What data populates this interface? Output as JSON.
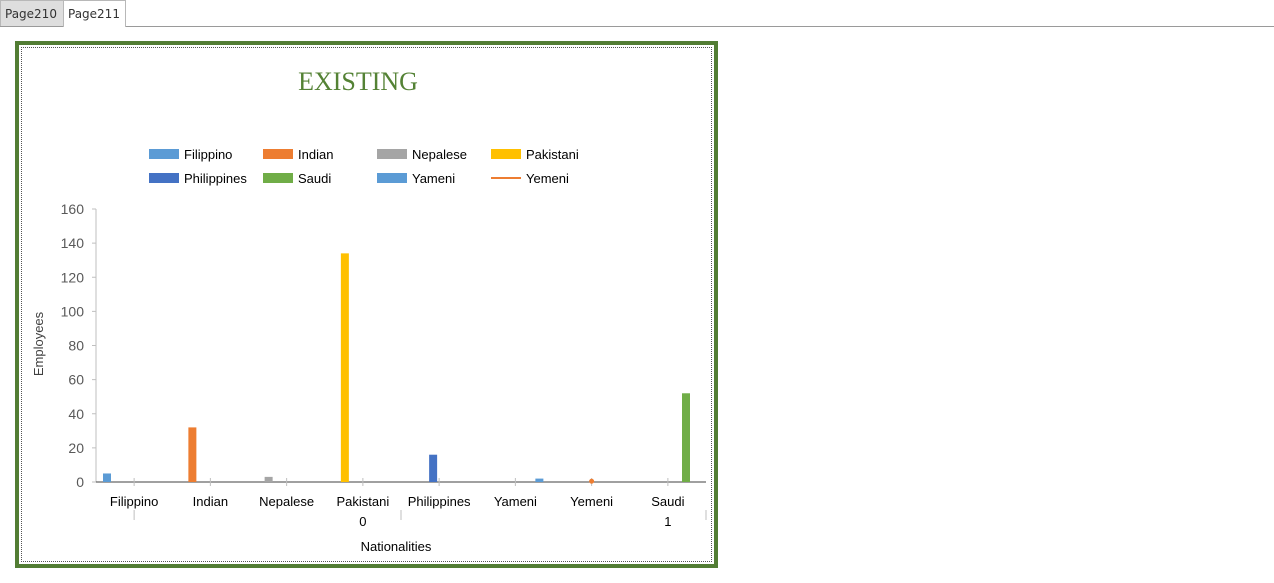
{
  "tabs": [
    {
      "label": "Page210",
      "active": false
    },
    {
      "label": "Page211",
      "active": true
    }
  ],
  "colors": {
    "frame": "#527d34",
    "title": "#548235"
  },
  "chart_data": {
    "type": "bar",
    "title": "EXISTING",
    "xlabel": "Nationalities",
    "ylabel": "Employees",
    "ylim": [
      0,
      160
    ],
    "yticks": [
      0,
      20,
      40,
      60,
      80,
      100,
      120,
      140,
      160
    ],
    "categories": [
      "Filippino",
      "Indian",
      "Nepalese",
      "Pakistani",
      "Philippines",
      "Yameni",
      "Yemeni",
      "Saudi"
    ],
    "sub_labels": [
      "",
      "",
      "",
      "0",
      "",
      "",
      "",
      "1"
    ],
    "legend_position": "top",
    "series": [
      {
        "name": "Filippino",
        "color": "#5b9bd5",
        "style": "bar",
        "values": [
          5,
          0,
          0,
          0,
          0,
          0,
          0,
          0
        ]
      },
      {
        "name": "Indian",
        "color": "#ed7d31",
        "style": "bar",
        "values": [
          0,
          32,
          0,
          0,
          0,
          0,
          0,
          0
        ]
      },
      {
        "name": "Nepalese",
        "color": "#a5a5a5",
        "style": "bar",
        "values": [
          0,
          0,
          3,
          0,
          0,
          0,
          0,
          0
        ]
      },
      {
        "name": "Pakistani",
        "color": "#ffc000",
        "style": "bar",
        "values": [
          0,
          0,
          0,
          134,
          0,
          0,
          0,
          0
        ]
      },
      {
        "name": "Philippines",
        "color": "#4472c4",
        "style": "bar",
        "values": [
          0,
          0,
          0,
          0,
          16,
          0,
          0,
          0
        ]
      },
      {
        "name": "Saudi",
        "color": "#70ad47",
        "style": "bar",
        "values": [
          0,
          0,
          0,
          0,
          0,
          0,
          0,
          52
        ]
      },
      {
        "name": "Yameni",
        "color": "#5b9bd5",
        "style": "bar",
        "values": [
          0,
          0,
          0,
          0,
          0,
          2,
          0,
          0
        ]
      },
      {
        "name": "Yemeni",
        "color": "#ed7d31",
        "style": "line",
        "values": [
          0,
          0,
          0,
          0,
          0,
          0,
          1,
          0
        ]
      }
    ]
  }
}
